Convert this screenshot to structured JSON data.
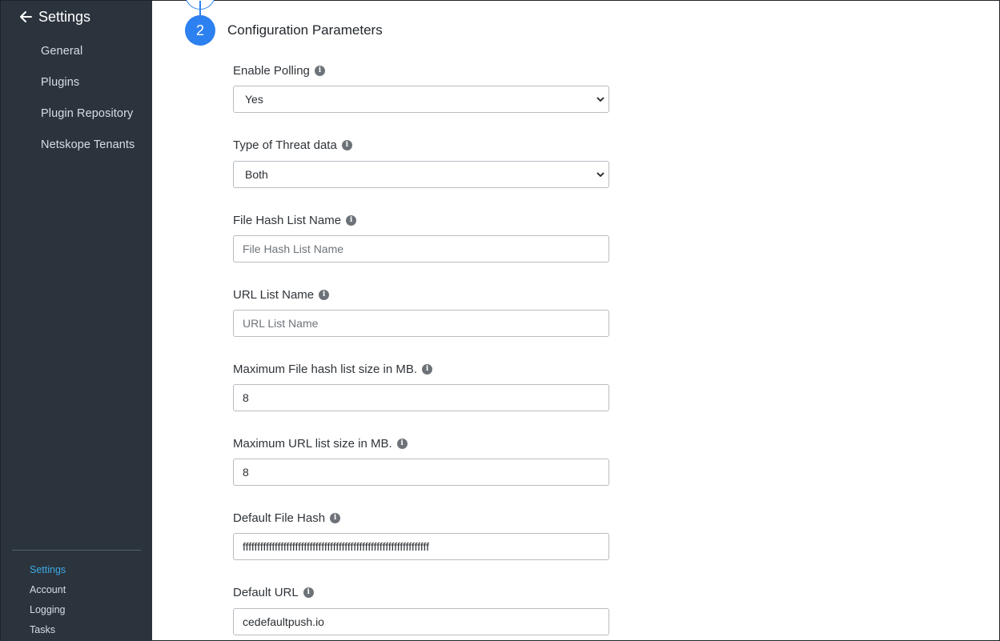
{
  "sidebar": {
    "title": "Settings",
    "back_icon": "arrow-left-icon",
    "nav": [
      "General",
      "Plugins",
      "Plugin Repository",
      "Netskope Tenants"
    ],
    "bottom": [
      "Settings",
      "Account",
      "Logging",
      "Tasks"
    ],
    "active_bottom": "Settings"
  },
  "step": {
    "number": "2",
    "title": "Configuration Parameters"
  },
  "fields": [
    {
      "label": "Enable Polling",
      "type": "select",
      "value": "Yes",
      "placeholder": ""
    },
    {
      "label": "Type of Threat data",
      "type": "select",
      "value": "Both",
      "placeholder": ""
    },
    {
      "label": "File Hash List Name",
      "type": "input",
      "value": "",
      "placeholder": "File Hash List Name"
    },
    {
      "label": "URL List Name",
      "type": "input",
      "value": "",
      "placeholder": "URL List Name"
    },
    {
      "label": "Maximum File hash list size in MB.",
      "type": "input",
      "value": "8",
      "placeholder": ""
    },
    {
      "label": "Maximum URL list size in MB.",
      "type": "input",
      "value": "8",
      "placeholder": ""
    },
    {
      "label": "Default File Hash",
      "type": "input",
      "value": "ffffffffffffffffffffffffffffffffffffffffffffffffffffffffffffffff",
      "placeholder": ""
    },
    {
      "label": "Default URL",
      "type": "input",
      "value": "cedefaultpush.io",
      "placeholder": ""
    }
  ],
  "colors": {
    "sidebar_bg": "#2b343d",
    "accent": "#2d80ef",
    "active_link": "#3fa9e6"
  },
  "icons": {
    "info": "info-circle-icon",
    "select": "chevron-down-icon"
  }
}
